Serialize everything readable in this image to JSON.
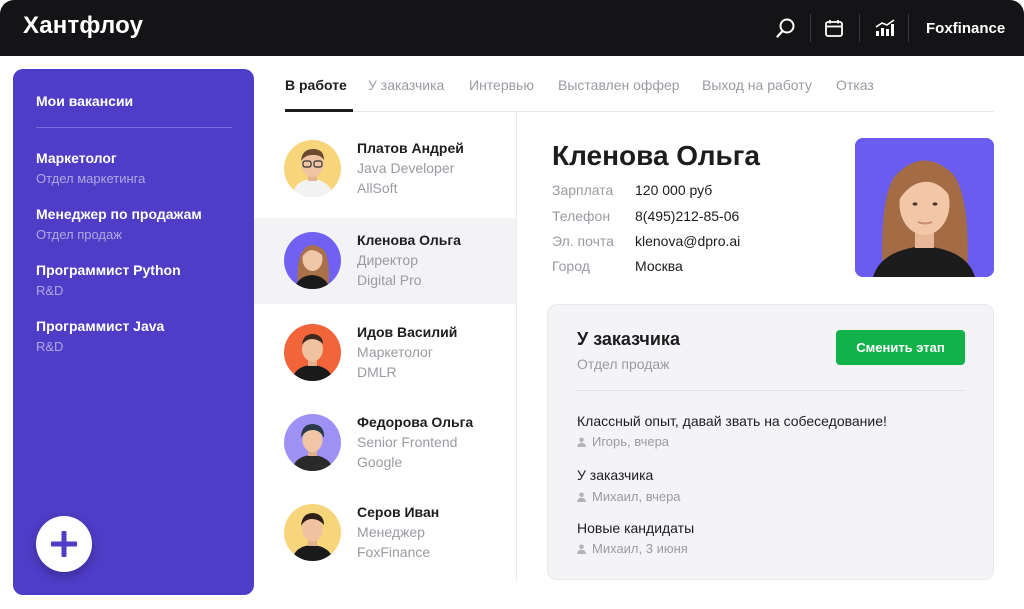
{
  "app": {
    "logo": "Хантфлоу",
    "company": "Foxfinance"
  },
  "icons": {
    "search": "search-icon",
    "calendar": "calendar-icon",
    "chart": "chart-icon",
    "add": "plus-icon",
    "user": "user-icon"
  },
  "colors": {
    "sidebar": "#4e3dc7",
    "topbar": "#141416",
    "accent_green": "#12b24a"
  },
  "sidebar": {
    "title": "Мои вакансии",
    "items": [
      {
        "title": "Маркетолог",
        "subtitle": "Отдел маркетинга"
      },
      {
        "title": "Менеджер по продажам",
        "subtitle": "Отдел продаж"
      },
      {
        "title": "Программист Python",
        "subtitle": "R&D"
      },
      {
        "title": "Программист Java",
        "subtitle": "R&D"
      }
    ]
  },
  "tabs": [
    {
      "label": "В работе",
      "active": true
    },
    {
      "label": "У заказчика",
      "active": false
    },
    {
      "label": "Интервью",
      "active": false
    },
    {
      "label": "Выставлен оффер",
      "active": false
    },
    {
      "label": "Выход на работу",
      "active": false
    },
    {
      "label": "Отказ",
      "active": false
    }
  ],
  "candidates": [
    {
      "name": "Платов Андрей",
      "role": "Java Developer",
      "org": "AllSoft"
    },
    {
      "name": "Кленова Ольга",
      "role": "Директор",
      "org": "Digital Pro",
      "selected": true
    },
    {
      "name": "Идов Василий",
      "role": "Маркетолог",
      "org": "DMLR"
    },
    {
      "name": "Федорова Ольга",
      "role": "Senior Frontend",
      "org": "Google"
    },
    {
      "name": "Серов Иван",
      "role": "Менеджер",
      "org": "FoxFinance"
    }
  ],
  "detail": {
    "name": "Кленова Ольга",
    "fields": [
      {
        "label": "Зарплата",
        "value": "120 000 руб"
      },
      {
        "label": "Телефон",
        "value": "8(495)212-85-06"
      },
      {
        "label": "Эл. почта",
        "value": "klenova@dpro.ai"
      },
      {
        "label": "Город",
        "value": "Москва"
      }
    ]
  },
  "stage": {
    "title": "У заказчика",
    "subtitle": "Отдел продаж",
    "button_label": "Сменить этап",
    "entries": [
      {
        "text": "Классный опыт, давай звать на собеседование!",
        "meta": "Игорь, вчера"
      },
      {
        "text": "У заказчика",
        "meta": "Михаил, вчера"
      },
      {
        "text": "Новые кандидаты",
        "meta": "Михаил, 3 июня"
      }
    ]
  }
}
